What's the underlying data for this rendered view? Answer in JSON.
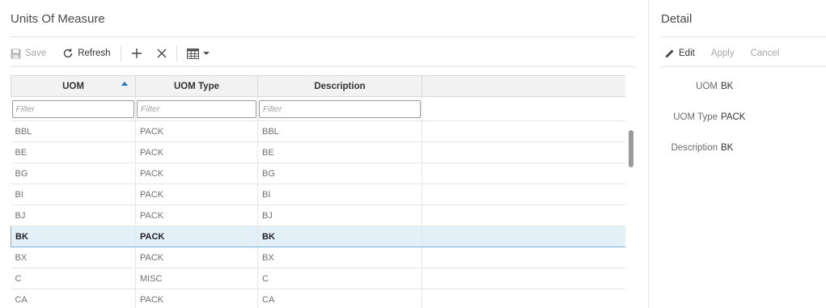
{
  "left_panel": {
    "title": "Units Of Measure",
    "toolbar": {
      "save_label": "Save",
      "refresh_label": "Refresh"
    },
    "grid": {
      "columns": [
        "UOM",
        "UOM Type",
        "Description"
      ],
      "filter_placeholders": [
        "Filter",
        "Filter",
        "Filter"
      ],
      "rows": [
        [
          "BBL",
          "PACK",
          "BBL"
        ],
        [
          "BE",
          "PACK",
          "BE"
        ],
        [
          "BG",
          "PACK",
          "BG"
        ],
        [
          "BI",
          "PACK",
          "BI"
        ],
        [
          "BJ",
          "PACK",
          "BJ"
        ],
        [
          "BK",
          "PACK",
          "BK"
        ],
        [
          "BX",
          "PACK",
          "BX"
        ],
        [
          "C",
          "MISC",
          "C"
        ],
        [
          "CA",
          "PACK",
          "CA"
        ]
      ]
    }
  },
  "right_panel": {
    "title": "Detail",
    "toolbar": {
      "edit_label": "Edit",
      "apply_label": "Apply",
      "cancel_label": "Cancel"
    },
    "fields": [
      {
        "label": "UOM",
        "value": "BK"
      },
      {
        "label": "UOM Type",
        "value": "PACK"
      },
      {
        "label": "Description",
        "value": "BK"
      }
    ]
  },
  "colors": {
    "selected_row_bg": "#e3f0f8",
    "selected_row_border": "#7fb2d8",
    "sort_arrow": "#1a73c6"
  }
}
